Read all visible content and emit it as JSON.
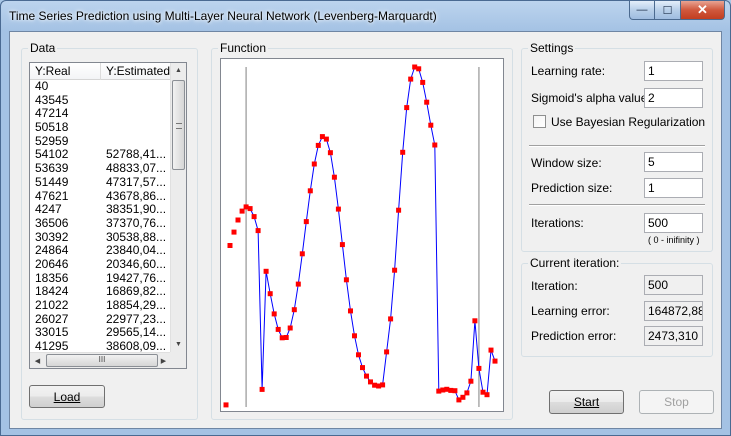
{
  "window": {
    "title": "Time Series Prediction using Multi-Layer Neural Network (Levenberg-Marquardt)",
    "minimize_glyph": "—",
    "maximize_glyph": "☐",
    "close_glyph": "✕"
  },
  "data_group": {
    "label": "Data",
    "columns": [
      "Y:Real",
      "Y:Estimated"
    ],
    "rows": [
      [
        "40",
        ""
      ],
      [
        "43545",
        ""
      ],
      [
        "47214",
        ""
      ],
      [
        "50518",
        ""
      ],
      [
        "52959",
        ""
      ],
      [
        "54102",
        "52788,41..."
      ],
      [
        "53639",
        "48833,07..."
      ],
      [
        "51449",
        "47317,57..."
      ],
      [
        "47621",
        "43678,86..."
      ],
      [
        "4247",
        "38351,90..."
      ],
      [
        "36506",
        "37370,76..."
      ],
      [
        "30392",
        "30538,88..."
      ],
      [
        "24864",
        "23840,04..."
      ],
      [
        "20646",
        "20346,60..."
      ],
      [
        "18356",
        "19427,76..."
      ],
      [
        "18424",
        "16869,82..."
      ],
      [
        "21022",
        "18854,29..."
      ],
      [
        "26027",
        "22977,23..."
      ],
      [
        "33015",
        "29565,14..."
      ],
      [
        "41295",
        "38608,09..."
      ]
    ],
    "hscroll_grip": "III",
    "load_label": "Load"
  },
  "function_group": {
    "label": "Function"
  },
  "settings": {
    "label": "Settings",
    "learning_rate_label": "Learning rate:",
    "learning_rate": "1",
    "sigmoid_label": "Sigmoid's alpha value:",
    "sigmoid": "2",
    "bayesian_label": "Use Bayesian Regularization",
    "bayesian_checked": false,
    "window_size_label": "Window size:",
    "window_size": "5",
    "prediction_size_label": "Prediction size:",
    "prediction_size": "1",
    "iterations_label": "Iterations:",
    "iterations": "500",
    "iterations_hint": "( 0 - inifinity )"
  },
  "current_iteration": {
    "label": "Current iteration:",
    "iteration_label": "Iteration:",
    "iteration": "500",
    "learning_error_label": "Learning error:",
    "learning_error": "164872,880",
    "prediction_error_label": "Prediction error:",
    "prediction_error": "2473,310"
  },
  "buttons": {
    "start_label": "Start",
    "stop_label": "Stop"
  },
  "colors": {
    "points": "#ff0000",
    "curve": "#0000ff",
    "window_markers": "#808080"
  },
  "chart_data": {
    "type": "scatter",
    "x": [
      0,
      1,
      2,
      3,
      4,
      5,
      6,
      7,
      8,
      9,
      10,
      11,
      12,
      13,
      14,
      15,
      16,
      17,
      18,
      19,
      20,
      21,
      22,
      23,
      24,
      25,
      26,
      27,
      28,
      29,
      30,
      31,
      32,
      33,
      34,
      35,
      36,
      37,
      38,
      39,
      40,
      41,
      42,
      43,
      44,
      45,
      46,
      47,
      48,
      49,
      50,
      51,
      52,
      53,
      54,
      55,
      56,
      57,
      58,
      59,
      60,
      61,
      62,
      63,
      64,
      65,
      66,
      67
    ],
    "y_real": [
      40,
      43545,
      47214,
      50518,
      52959,
      54102,
      53639,
      51449,
      47621,
      4247,
      36506,
      30392,
      24864,
      20646,
      18356,
      18424,
      21022,
      26027,
      33015,
      41295,
      50070,
      58500,
      65800,
      70900,
      73300,
      72600,
      68900,
      62200,
      53500,
      43800,
      34200,
      25700,
      18900,
      13700,
      10200,
      7900,
      6300,
      5400,
      5200,
      5500,
      14500,
      23500,
      36800,
      53200,
      69000,
      81200,
      89000,
      92300,
      91800,
      88100,
      82700,
      76400,
      71000,
      3800,
      4100,
      4300,
      4000,
      3900,
      1400,
      2100,
      3300,
      6500,
      23000,
      10000,
      3500,
      2800,
      15000,
      12000
    ],
    "series": [
      {
        "name": "",
        "values": [
          52788,
          48833,
          47317,
          43678,
          38351,
          37370,
          30538,
          23840,
          20346,
          19427,
          16869,
          18854,
          22977,
          29565,
          38608
        ]
      }
    ]
  }
}
